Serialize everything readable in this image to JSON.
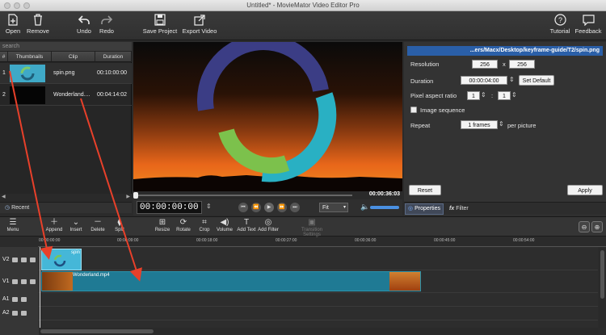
{
  "window": {
    "title": "Untitled* - MovieMator Video Editor Pro"
  },
  "toolbar": {
    "open": "Open",
    "remove": "Remove",
    "undo": "Undo",
    "redo": "Redo",
    "save_project": "Save Project",
    "export_video": "Export Video",
    "tutorial": "Tutorial",
    "feedback": "Feedback"
  },
  "clips": {
    "search_placeholder": "search",
    "headers": [
      "#",
      "Thumbnails",
      "Clip",
      "Duration"
    ],
    "rows": [
      {
        "index": "1",
        "name": "spin.png",
        "duration": "00:10:00:00"
      },
      {
        "index": "2",
        "name": "Wonderland....",
        "duration": "00:04:14:02"
      }
    ],
    "recent_label": "Recent"
  },
  "player": {
    "current_time": "00:00:00:00",
    "total_time": "00:00:36:03",
    "zoom": "Fit"
  },
  "properties": {
    "path": "...ers/Macx/Desktop/keyframe-guide/T2/spin.png",
    "resolution_label": "Resolution",
    "res_w": "256",
    "res_x": "x",
    "res_h": "256",
    "duration_label": "Duration",
    "duration": "00:00:04:00",
    "set_default": "Set Default",
    "par_label": "Pixel aspect ratio",
    "par_a": "1",
    "par_colon": ":",
    "par_b": "1",
    "image_sequence": "Image sequence",
    "repeat_label": "Repeat",
    "repeat_value": "1 frames",
    "per_picture": "per picture",
    "reset": "Reset",
    "apply": "Apply",
    "tab_properties": "Properties",
    "tab_filter": "Filter"
  },
  "timeline": {
    "tools": [
      "Menu",
      "Append",
      "Insert",
      "Delete",
      "Split",
      "Resize",
      "Rotate",
      "Crop",
      "Volume",
      "Add Text",
      "Add Filter",
      "Transition Settings"
    ],
    "ruler": [
      "00:00:00:00",
      "00:00:09:00",
      "00:00:18:00",
      "00:00:27:00",
      "00:00:36:00",
      "00:00:45:00",
      "00:00:54:00"
    ],
    "tracks": [
      "V2",
      "V1",
      "A1",
      "A2"
    ],
    "v2_clip": "spin",
    "v1_clip": "Wonderland.mp4"
  },
  "colors": {
    "accent": "#2a5fa8",
    "clip_v2": "#45b7d8",
    "clip_v1": "#1f7a94",
    "arrow": "#e8402a"
  }
}
